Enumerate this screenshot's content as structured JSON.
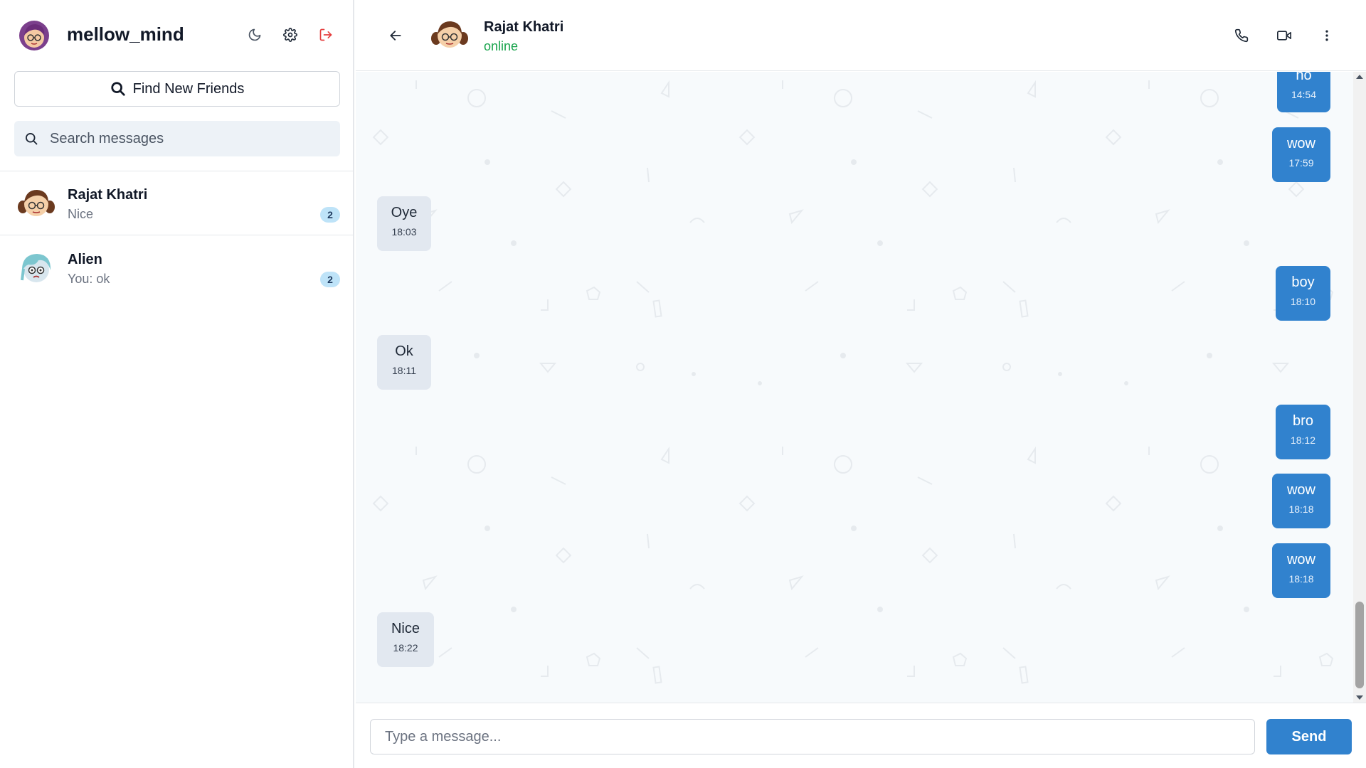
{
  "app": {
    "username": "mellow_mind",
    "find_friends_label": "Find New Friends",
    "search_placeholder": "Search messages",
    "accent_color": "#3182ce",
    "online_color": "#16a34a",
    "logout_color": "#e53e3e"
  },
  "header_icons": [
    "moon-icon",
    "gear-icon",
    "logout-icon"
  ],
  "conversations": [
    {
      "name": "Rajat Khatri",
      "preview": "Nice",
      "unread": "2",
      "avatar": "girl-avatar"
    },
    {
      "name": "Alien",
      "preview": "You: ok",
      "unread": "2",
      "avatar": "alien-avatar"
    }
  ],
  "chat": {
    "name": "Rajat Khatri",
    "status": "online",
    "icons": [
      "back-arrow-icon",
      "phone-icon",
      "video-icon",
      "more-vertical-icon"
    ]
  },
  "messages": [
    {
      "text": "ho",
      "time": "14:54",
      "direction": "out"
    },
    {
      "text": "wow",
      "time": "17:59",
      "direction": "out"
    },
    {
      "text": "Oye",
      "time": "18:03",
      "direction": "in"
    },
    {
      "text": "boy",
      "time": "18:10",
      "direction": "out"
    },
    {
      "text": "Ok",
      "time": "18:11",
      "direction": "in"
    },
    {
      "text": "bro",
      "time": "18:12",
      "direction": "out"
    },
    {
      "text": "wow",
      "time": "18:18",
      "direction": "out"
    },
    {
      "text": "wow",
      "time": "18:18",
      "direction": "out"
    },
    {
      "text": "Nice",
      "time": "18:22",
      "direction": "in"
    }
  ],
  "composer": {
    "placeholder": "Type a message...",
    "send_label": "Send"
  }
}
